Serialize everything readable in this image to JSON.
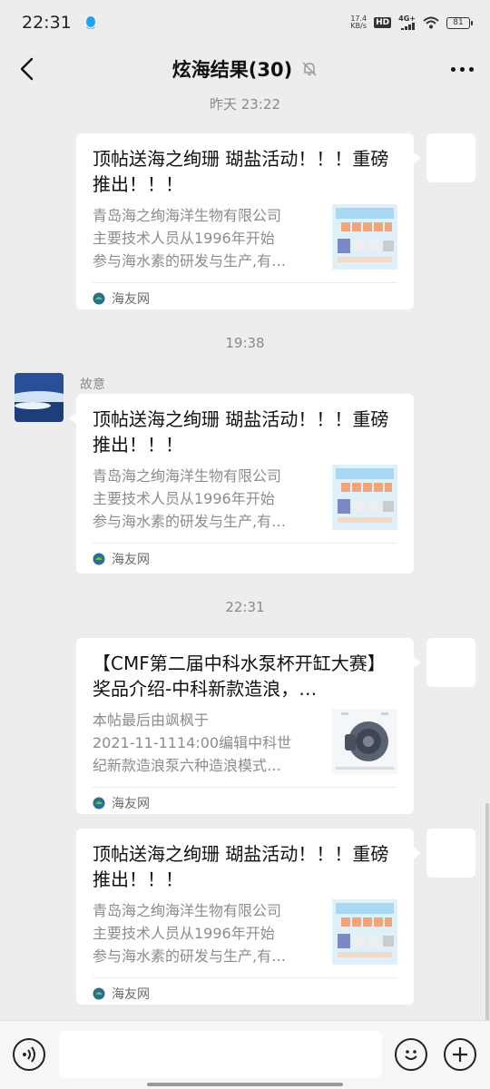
{
  "status_bar": {
    "time": "22:31",
    "net_speed_value": "17.4",
    "net_speed_unit": "KB/s",
    "hd": "HD",
    "signal": "4G+",
    "battery": "81"
  },
  "nav": {
    "title": "炫海结果(30)"
  },
  "messages": [
    {
      "timestamp": "昨天 23:22"
    },
    {
      "timestamp": "19:38"
    },
    {
      "timestamp": "22:31"
    }
  ],
  "cards": [
    {
      "title": "顶帖送海之绚珊 瑚盐活动！！！重磅推出！！！",
      "desc_lines": [
        "青岛海之绚海洋生物有限公司",
        "主要技术人员从1996年开始",
        "参与海水素的研发与生产,有…"
      ],
      "source": "海友网"
    },
    {
      "title": "顶帖送海之绚珊 瑚盐活动！！！重磅推出！！！",
      "desc_lines": [
        "青岛海之绚海洋生物有限公司",
        "主要技术人员从1996年开始",
        "参与海水素的研发与生产,有…"
      ],
      "source": "海友网"
    },
    {
      "title": "【CMF第二届中科水泵杯开缸大赛】奖品介绍-中科新款造浪，…",
      "desc_lines": [
        "本帖最后由飒枫于",
        "2021-11-1114:00编辑中科世",
        "纪新款造浪泵六种造浪模式…"
      ],
      "source": "海友网"
    },
    {
      "title": "顶帖送海之绚珊 瑚盐活动！！！重磅推出！！！",
      "desc_lines": [
        "青岛海之绚海洋生物有限公司",
        "主要技术人员从1996年开始",
        "参与海水素的研发与生产,有…"
      ],
      "source": "海友网"
    }
  ],
  "sender": {
    "name": "故意"
  },
  "icons": {
    "back": "chevron-left-icon",
    "mute": "bell-off-icon",
    "more": "more-dots-icon",
    "voice": "voice-icon",
    "emoji": "emoji-icon",
    "plus": "plus-icon",
    "source": "haiyou-logo-icon"
  },
  "colors": {
    "background": "#ededed",
    "bubble": "#ffffff",
    "muted_text": "#8c8c8c"
  }
}
